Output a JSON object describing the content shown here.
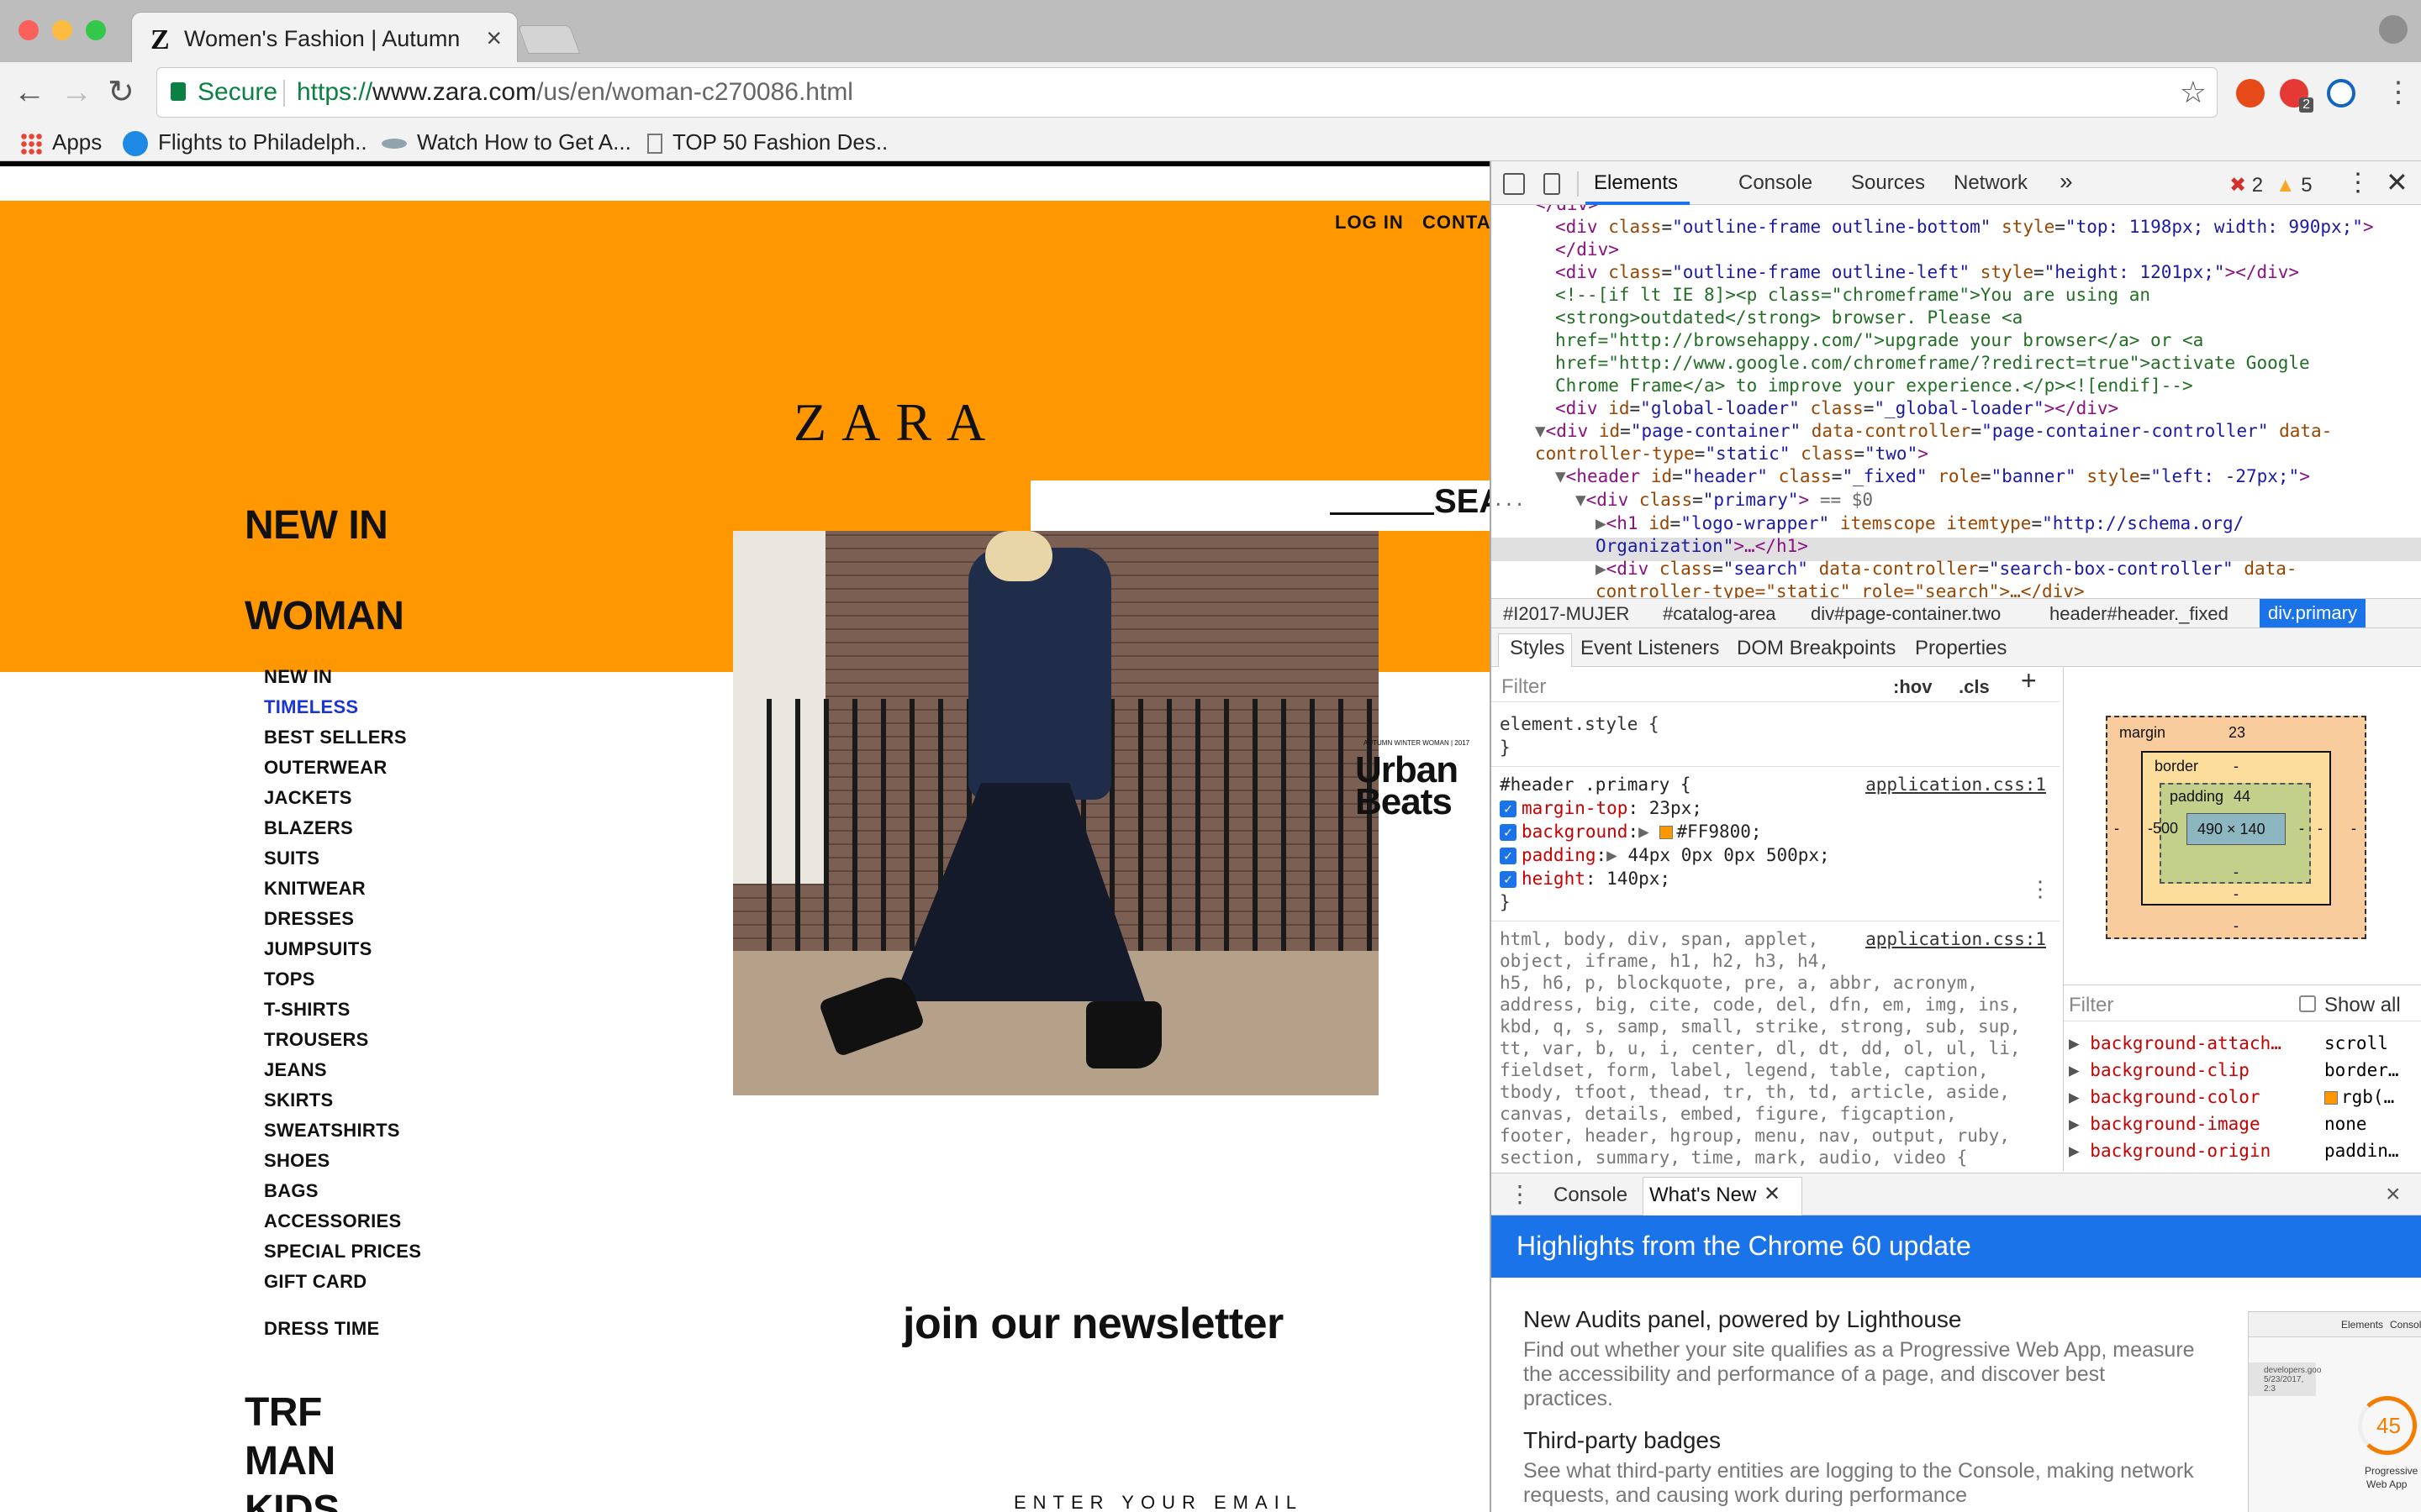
{
  "browser": {
    "tab_title": "Women's Fashion | Autumn Wi",
    "tab_favicon": "Z",
    "secure_label": "Secure",
    "url_scheme": "https://",
    "url_host": "www.zara.com",
    "url_path": "/us/en/woman-c270086.html",
    "ext_badge": "2",
    "bookmarks": [
      {
        "label": "Apps",
        "icon": "apps-grid-icon"
      },
      {
        "label": "Flights to Philadelph..",
        "icon": "plane-icon"
      },
      {
        "label": "Watch How to Get A...",
        "icon": "fish-icon"
      },
      {
        "label": "TOP 50 Fashion Des..",
        "icon": "page-icon"
      }
    ]
  },
  "page": {
    "login": "LOG IN",
    "contact": "CONTAC",
    "logo": "ZARA",
    "search": "SEA",
    "brand_color": "#FF9800",
    "menu_big": [
      "NEW IN",
      "WOMAN"
    ],
    "menu_items": [
      "NEW IN",
      "TIMELESS",
      "BEST SELLERS",
      "OUTERWEAR",
      "JACKETS",
      "BLAZERS",
      "SUITS",
      "KNITWEAR",
      "DRESSES",
      "JUMPSUITS",
      "TOPS",
      "T-SHIRTS",
      "TROUSERS",
      "JEANS",
      "SKIRTS",
      "SWEATSHIRTS",
      "SHOES",
      "BAGS",
      "ACCESSORIES",
      "SPECIAL PRICES",
      "GIFT CARD"
    ],
    "menu_active": "TIMELESS",
    "menu_extra": "DRESS TIME",
    "menu_big_bottom": [
      "TRF",
      "MAN",
      "KIDS"
    ],
    "hero_small": "AUTUMN WINTER WOMAN | 2017",
    "hero_title_1": "Urban",
    "hero_title_2": "Beats",
    "newsletter": "join our newsletter",
    "email_label": "ENTER YOUR EMAIL"
  },
  "devtools": {
    "tabs": [
      "Elements",
      "Console",
      "Sources",
      "Network"
    ],
    "more": "»",
    "errors": "2",
    "warnings": "5",
    "breadcrumbs": [
      "#I2017-MUJER",
      "#catalog-area",
      "div#page-container.two",
      "header#header._fixed",
      "div.primary"
    ],
    "style_tabs": [
      "Styles",
      "Event Listeners",
      "DOM Breakpoints",
      "Properties"
    ],
    "filter_placeholder": "Filter",
    "hov": ":hov",
    "cls": ".cls",
    "element_style": "element.style {",
    "close_brace": "}",
    "rule1_selector": "#header .primary {",
    "rule1_source": "application.css:1",
    "rule1_props": [
      {
        "name": "margin-top",
        "value": "23px;"
      },
      {
        "name": "background",
        "value": "#FF9800;"
      },
      {
        "name": "padding",
        "value": "44px 0px 0px 500px;"
      },
      {
        "name": "height",
        "value": "140px;"
      }
    ],
    "rule2_source": "application.css:1",
    "rule2_lines": [
      "html, body, div, span, applet,",
      "object, iframe, h1, h2, h3, h4,",
      "h5, h6, p, blockquote, pre, a, abbr, acronym,",
      "address, big, cite, code, del, dfn, em, img, ins,",
      "kbd, q, s, samp, small, strike, strong, sub, sup,",
      "tt, var, b, u, i, center, dl, dt, dd, ol, ul, li,",
      "fieldset, form, label, legend, table, caption,",
      "tbody, tfoot, thead, tr, th, td, article, aside,",
      "canvas, details, embed, figure, figcaption,",
      "footer, header, hgroup, menu, nav, output, ruby,",
      "section, summary, time, mark, audio, video {"
    ],
    "box_model": {
      "margin_label": "margin",
      "margin_top": "23",
      "margin_bottom": "-",
      "border_label": "border",
      "border_top": "-",
      "border_bottom": "-",
      "padding_label": "padding",
      "padding_top": "44",
      "padding_left": "500",
      "padding_right": "-",
      "padding_bottom": "-",
      "content": "490 × 140",
      "side_dash": "-"
    },
    "computed_filter": "Filter",
    "show_all": "Show all",
    "computed": [
      {
        "name": "background-attach…",
        "value": "scroll"
      },
      {
        "name": "background-clip",
        "value": "border…"
      },
      {
        "name": "background-color",
        "value": "rgb(…"
      },
      {
        "name": "background-image",
        "value": "none"
      },
      {
        "name": "background-origin",
        "value": "paddin…"
      }
    ],
    "drawer_tabs": [
      "Console",
      "What's New"
    ],
    "drawer_close": "×",
    "whatsnew_title": "Highlights from the Chrome 60 update",
    "whatsnew_items": [
      {
        "title": "New Audits panel, powered by Lighthouse",
        "body": "Find out whether your site qualifies as a Progressive Web App, measure the accessibility and performance of a page, and discover best practices."
      },
      {
        "title": "Third-party badges",
        "body": "See what third-party entities are logging to the Console, making network requests, and causing work during performance"
      }
    ],
    "thumb": {
      "tab1": "Elements",
      "tab2": "Consol",
      "site": "developers.goo",
      "date": "5/23/2017, 2:3",
      "score": "45",
      "score_label_1": "Progressive",
      "score_label_2": "Web App"
    },
    "dom_lines": {
      "l0": "</div>",
      "l1_attr": "\"outline-frame outline-bottom\"",
      "l1_style": "\"top: 1198px; width: 990px;\"",
      "l3_attr": "\"outline-frame outline-left\"",
      "l3_style": "\"height: 1201px;\"",
      "cm1": "<!--[if lt IE 8]><p class=\"chromeframe\">You are using an",
      "cm2": "<strong>outdated</strong> browser. Please <a",
      "cm3": "href=\"http://browsehappy.com/\">upgrade your browser</a> or <a",
      "cm4": "href=\"http://www.google.com/chromeframe/?redirect=true\">activate Google",
      "cm5": "Chrome Frame</a> to improve your experience.</p><![endif]-->",
      "gl_id": "\"global-loader\"",
      "gl_class": "\"_global-loader\"",
      "pc_id": "\"page-container\"",
      "pc_ctrl": "\"page-container-controller\"",
      "pc_type": "\"static\"",
      "pc_class": "\"two\"",
      "hd_id": "\"header\"",
      "hd_class": "\"_fixed\"",
      "hd_role": "\"banner\"",
      "hd_style": "\"left: -27px;\"",
      "pr_class": "\"primary\"",
      "pr_marker": "== $0",
      "h1_id": "\"logo-wrapper\"",
      "h1_type": "\"http://schema.org/",
      "h1_org": "Organization\"",
      "sr_class": "\"search\"",
      "sr_ctrl": "\"search-box-controller\"",
      "sr_tail": "controller-type=\"static\" role=\"search\">…</div>"
    }
  }
}
